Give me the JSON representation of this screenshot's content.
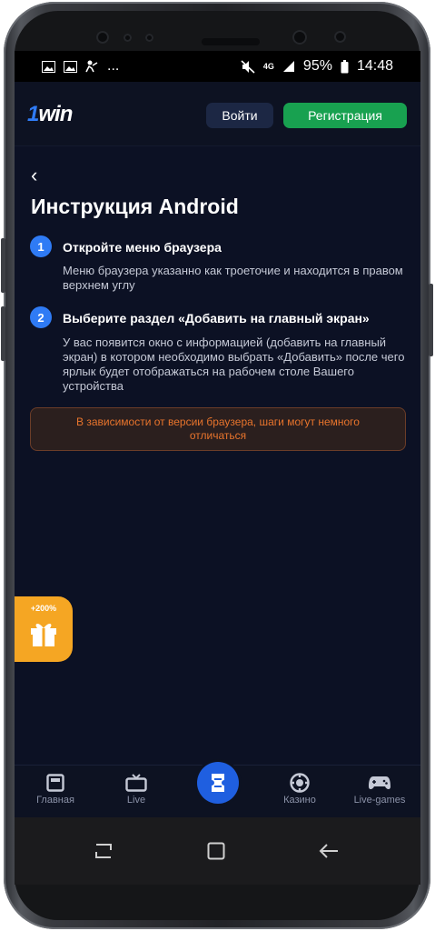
{
  "status_bar": {
    "ellipsis": "...",
    "network": "4G",
    "battery": "95%",
    "time": "14:48"
  },
  "header": {
    "logo_prefix": "1",
    "logo_suffix": "win",
    "login_label": "Войти",
    "register_label": "Регистрация"
  },
  "content": {
    "back": "‹",
    "title": "Инструкция Android",
    "steps": [
      {
        "number": "1",
        "title": "Откройте меню браузера",
        "text": "Меню браузера указанно как троеточие и находится в правом верхнем углу"
      },
      {
        "number": "2",
        "title": "Выберите раздел «Добавить на главный экран»",
        "text": "У вас появится окно с информацией (добавить на главный экран) в котором необходимо выбрать «Добавить» после чего ярлык будет отображаться на рабочем столе Вашего устройства"
      }
    ],
    "note": "В зависимости от версии браузера, шаги могут немного отличаться"
  },
  "gift_badge": {
    "label": "+200%"
  },
  "bottom_nav": {
    "items": [
      {
        "label": "Главная",
        "icon": "home-icon"
      },
      {
        "label": "Live",
        "icon": "tv-icon"
      },
      {
        "label": "",
        "icon": "ticket-icon"
      },
      {
        "label": "Казино",
        "icon": "casino-chip-icon"
      },
      {
        "label": "Live-games",
        "icon": "gamepad-icon"
      }
    ]
  },
  "colors": {
    "accent_blue": "#2f7bf5",
    "register_green": "#18a150",
    "note_orange": "#e8742c",
    "gift_orange": "#f5a623",
    "background": "#0c1124"
  }
}
